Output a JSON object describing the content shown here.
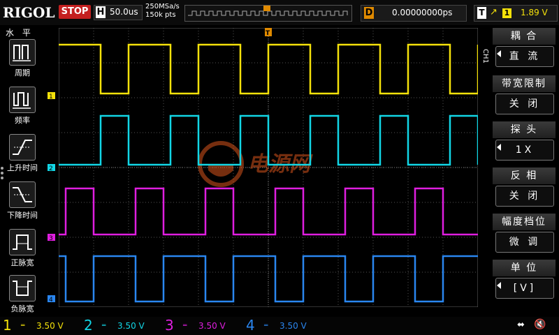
{
  "brand": "RIGOL",
  "run_status": "STOP",
  "timebase": {
    "key": "H",
    "value": "50.0us"
  },
  "acquisition": {
    "sample_rate": "250MSa/s",
    "memory_depth": "150k pts"
  },
  "delay": {
    "key": "D",
    "value": "0.00000000ps"
  },
  "trigger": {
    "key": "T",
    "source": "1",
    "level": "1.89 V"
  },
  "left_menu": {
    "title": "水 平",
    "items": [
      {
        "label": "周期",
        "icon": "period-icon"
      },
      {
        "label": "频率",
        "icon": "frequency-icon"
      },
      {
        "label": "上升时间",
        "icon": "rise-time-icon"
      },
      {
        "label": "下降时间",
        "icon": "fall-time-icon"
      },
      {
        "label": "正脉宽",
        "icon": "positive-width-icon"
      },
      {
        "label": "负脉宽",
        "icon": "negative-width-icon"
      }
    ]
  },
  "right_menu": {
    "channel_tab": "CH1",
    "items": [
      {
        "label": "耦 合",
        "value": "直 流"
      },
      {
        "label": "带宽限制",
        "value": "关 闭"
      },
      {
        "label": "探 头",
        "value": "1X"
      },
      {
        "label": "反 相",
        "value": "关 闭"
      },
      {
        "label": "幅度档位",
        "value": "微 调"
      },
      {
        "label": "单 位",
        "value": "[V]"
      }
    ]
  },
  "channels": [
    {
      "number": "1",
      "scale": "3.50 V",
      "color": "#f5e20a"
    },
    {
      "number": "2",
      "scale": "3.50 V",
      "color": "#12d6e6"
    },
    {
      "number": "3",
      "scale": "3.50 V",
      "color": "#e01ee0"
    },
    {
      "number": "4",
      "scale": "3.50 V",
      "color": "#2a86f0"
    }
  ],
  "watermark": {
    "text": "电源网"
  },
  "status_icons": {
    "usb": "usb-icon",
    "sound": "speaker-muted-icon"
  }
}
